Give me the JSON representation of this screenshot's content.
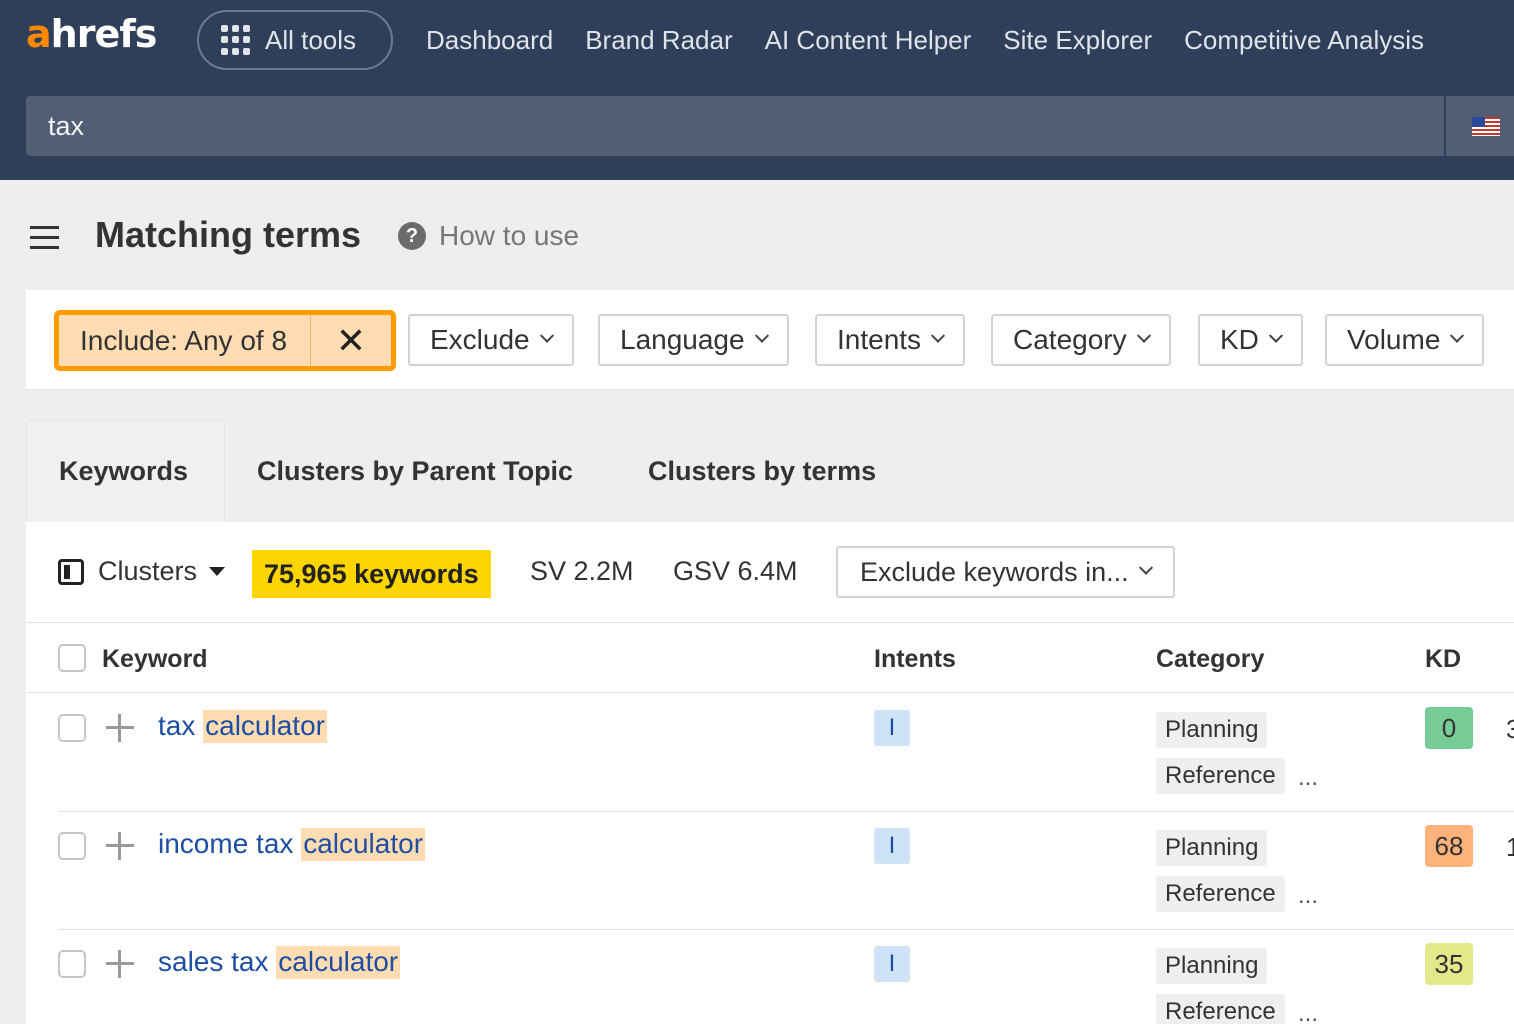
{
  "header": {
    "logo_a": "a",
    "logo_rest": "hrefs",
    "all_tools": "All tools",
    "nav": [
      "Dashboard",
      "Brand Radar",
      "AI Content Helper",
      "Site Explorer",
      "Competitive Analysis"
    ],
    "search_value": "tax",
    "flag_icon": "us-flag-icon"
  },
  "page": {
    "title": "Matching terms",
    "how_to_use": "How to use",
    "help_icon": "?"
  },
  "filters": {
    "include_label": "Include: Any of 8",
    "clear_glyph": "✕",
    "chips": [
      "Exclude",
      "Language",
      "Intents",
      "Category",
      "KD",
      "Volume"
    ]
  },
  "tabs": [
    "Keywords",
    "Clusters by Parent Topic",
    "Clusters by terms"
  ],
  "toolbar": {
    "clusters_label": "Clusters",
    "keyword_count": "75,965 keywords",
    "sv": "SV 2.2M",
    "gsv": "GSV 6.4M",
    "exclude_keywords": "Exclude keywords in..."
  },
  "table": {
    "columns": [
      "Keyword",
      "Intents",
      "Category",
      "KD"
    ],
    "rows": [
      {
        "kw_pre": "tax",
        "kw_hl": "calculator",
        "intent": "I",
        "cat1": "Planning",
        "cat2": "Reference",
        "more": "...",
        "kd": "0",
        "kd_color": "#77cc96",
        "peek": "3"
      },
      {
        "kw_pre": "income tax",
        "kw_hl": "calculator",
        "intent": "I",
        "cat1": "Planning",
        "cat2": "Reference",
        "more": "...",
        "kd": "68",
        "kd_color": "#ffb27a",
        "peek": "1"
      },
      {
        "kw_pre": "sales tax",
        "kw_hl": "calculator",
        "intent": "I",
        "cat1": "Planning",
        "cat2": "Reference",
        "more": "...",
        "kd": "35",
        "kd_color": "#e4e78a",
        "peek": ""
      }
    ]
  },
  "colors": {
    "header_bg": "#2f3e59",
    "accent_orange": "#ff9d00",
    "highlight": "#ffd500",
    "link": "#1d4ea3"
  }
}
